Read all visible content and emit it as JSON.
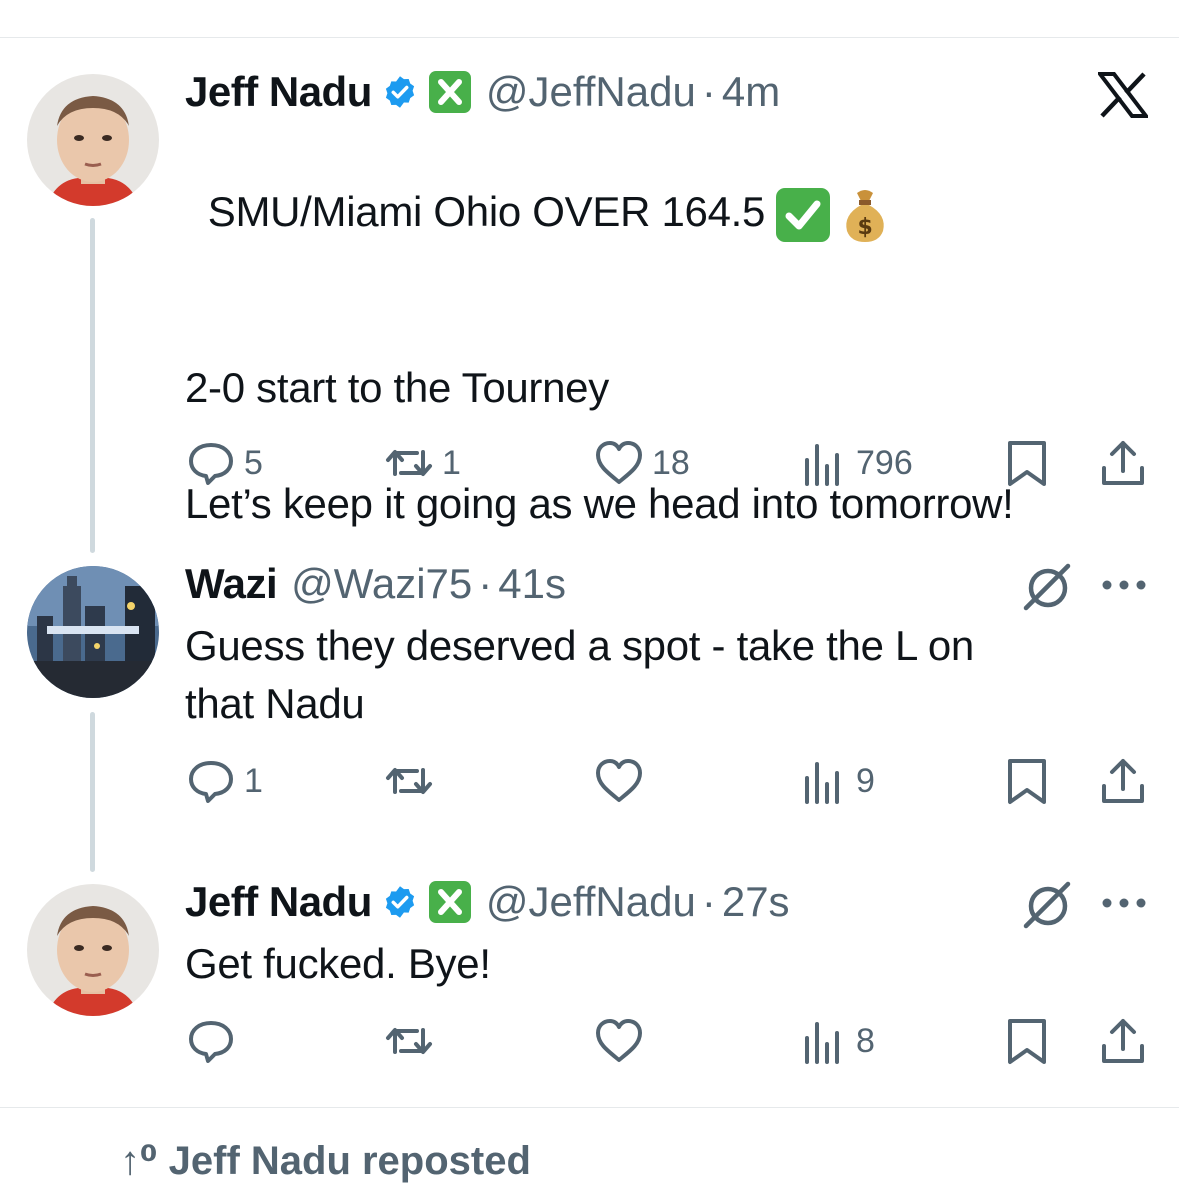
{
  "tweets": [
    {
      "name": "Jeff Nadu",
      "handle": "@JeffNadu",
      "dot": "·",
      "time": "4m",
      "text_line1": "SMU/Miami Ohio OVER 164.5",
      "text_rest": "\n2-0 start to the Tourney\n\nLet’s keep it going as we head into tomorrow!",
      "replies": "5",
      "retweets": "1",
      "likes": "18",
      "views": "796"
    },
    {
      "name": "Wazi",
      "handle": "@Wazi75",
      "dot": "·",
      "time": "41s",
      "text": "Guess they deserved a spot - take the L on\nthat Nadu",
      "replies": "1",
      "retweets": "",
      "likes": "",
      "views": "9"
    },
    {
      "name": "Jeff Nadu",
      "handle": "@JeffNadu",
      "dot": "·",
      "time": "27s",
      "text": "Get fucked. Bye!",
      "replies": "",
      "retweets": "",
      "likes": "",
      "views": "8"
    }
  ],
  "footer_peek": "↑⁰ Jeff Nadu reposted",
  "icons": {
    "verified": "verified-badge-icon",
    "x_square": "x-square-emoji",
    "check": "check-mark-button-emoji",
    "money_bag": "money-bag-emoji",
    "x_logo": "x-logo-icon",
    "grok": "grok-icon",
    "more": "more-icon"
  },
  "colors": {
    "verified_blue": "#1d9bf0",
    "green_emoji": "#48b04a",
    "muted": "#536471"
  }
}
